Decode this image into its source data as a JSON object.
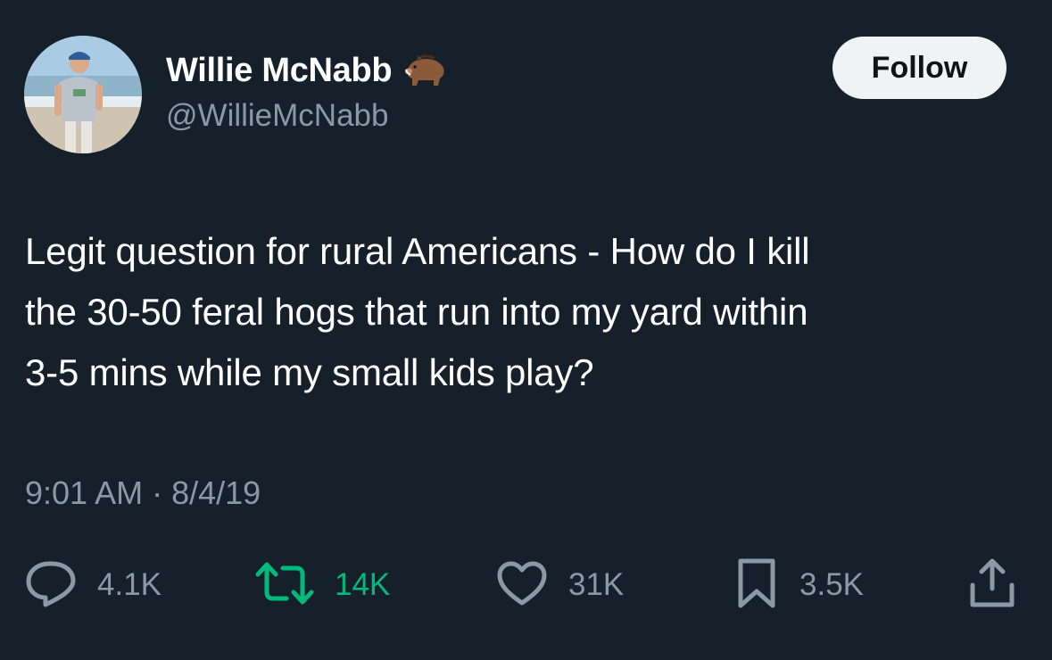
{
  "author": {
    "display_name": "Willie McNabb",
    "handle": "@WillieMcNabb",
    "name_emoji": "boar-icon"
  },
  "header": {
    "follow_label": "Follow"
  },
  "tweet": {
    "lines": [
      "Legit question for rural Americans - How do I kill",
      "the 30-50 feral hogs that run into my yard within",
      "3-5 mins while my small kids play?"
    ],
    "timestamp": "9:01 AM · 8/4/19"
  },
  "actions": {
    "reply": {
      "icon": "reply-icon",
      "count": "4.1K"
    },
    "retweet": {
      "icon": "retweet-icon",
      "count": "14K",
      "color": "#00ba7c"
    },
    "like": {
      "icon": "heart-icon",
      "count": "31K"
    },
    "bookmark": {
      "icon": "bookmark-icon",
      "count": "3.5K"
    },
    "share": {
      "icon": "share-icon"
    }
  },
  "colors": {
    "background": "#15202b",
    "text_primary": "#ffffff",
    "text_secondary": "#8b98a5",
    "follow_bg": "#eff3f4",
    "retweet_active": "#00ba7c"
  }
}
